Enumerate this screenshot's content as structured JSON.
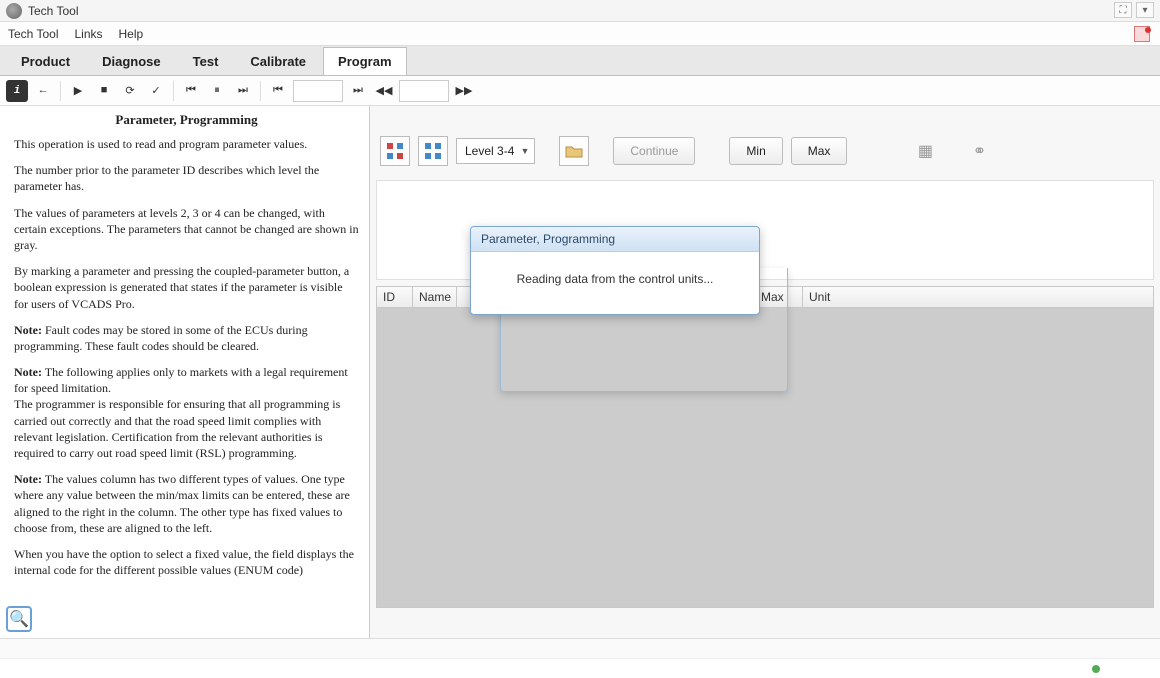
{
  "window": {
    "title": "Tech Tool"
  },
  "menubar": {
    "items": [
      "Tech Tool",
      "Links",
      "Help"
    ]
  },
  "tabs": {
    "items": [
      "Product",
      "Diagnose",
      "Test",
      "Calibrate",
      "Program"
    ],
    "active": 4
  },
  "left_panel": {
    "heading": "Parameter, Programming",
    "para1": "This operation is used to read and program parameter values.",
    "para2": "The number prior to the parameter ID describes which level the parameter has.",
    "para3": "The values of parameters at levels 2, 3 or 4 can be changed, with certain exceptions. The parameters that cannot be changed are shown in gray.",
    "para4": "By marking a parameter and pressing the coupled-parameter button, a boolean expression is generated that states if the parameter is visible for users of VCADS Pro.",
    "note1_label": "Note:",
    "note1_text": " Fault codes may be stored in some of the ECUs during programming. These fault codes should be cleared.",
    "note2_label": "Note:",
    "note2_text": " The following applies only to markets with a legal requirement for speed limitation.",
    "note2_cont": "The programmer is responsible for ensuring that all programming is carried out correctly and that the road speed limit complies with relevant legislation. Certification from the relevant authorities is required to carry out road speed limit (RSL) programming.",
    "note3_label": "Note:",
    "note3_text": " The values column has two different types of values. One type where any value between the min/max limits can be entered, these are aligned to the right in the column. The other type has fixed values to choose from, these are aligned to the left.",
    "para5": "When you have the option to select a fixed value, the field displays the internal code for the different possible values (ENUM code)"
  },
  "right_toolbar": {
    "level_label": "Level 3-4",
    "continue_label": "Continue",
    "min_label": "Min",
    "max_label": "Max"
  },
  "table": {
    "columns": {
      "id": "ID",
      "name": "Name",
      "max": "Max",
      "unit": "Unit"
    }
  },
  "dialog": {
    "title": "Parameter, Programming",
    "message": "Reading data from the control units..."
  }
}
